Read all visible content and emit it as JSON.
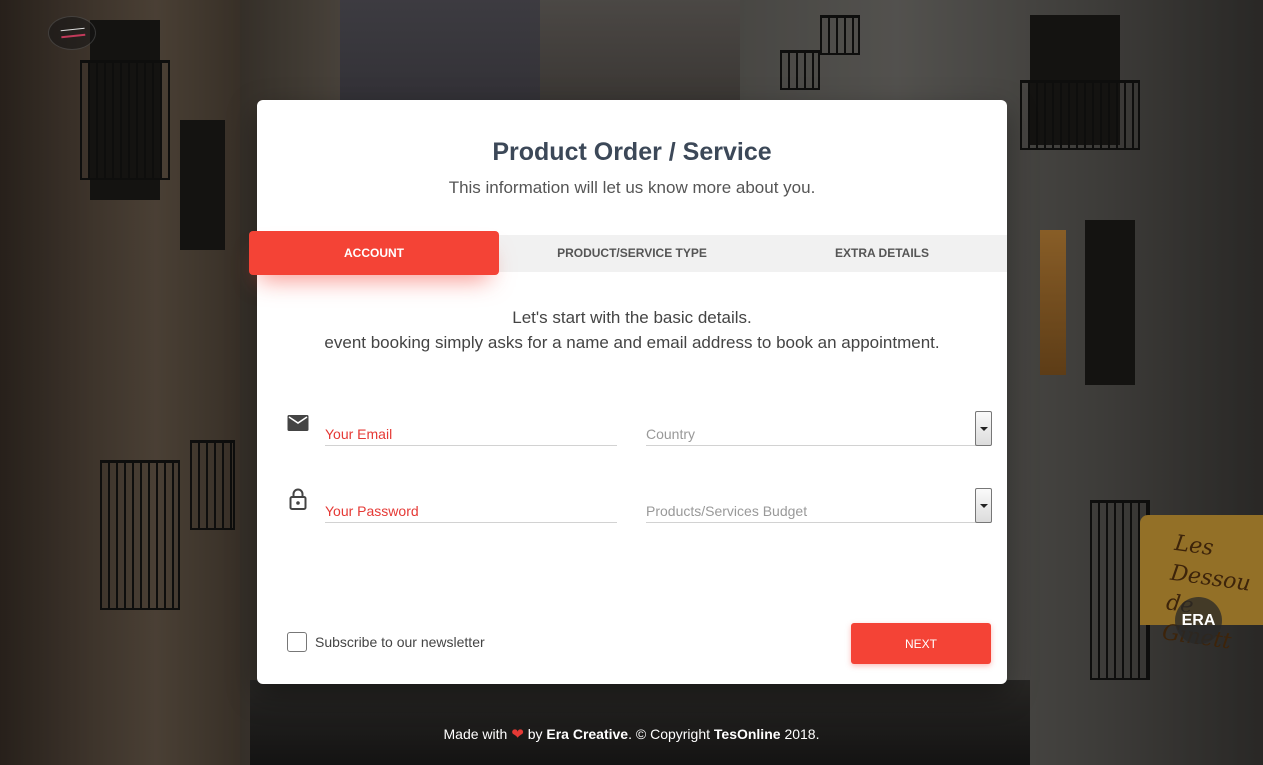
{
  "form": {
    "title": "Product Order / Service",
    "subtitle": "This information will let us know more about you.",
    "tabs": [
      {
        "label": "ACCOUNT",
        "active": true
      },
      {
        "label": "PRODUCT/SERVICE TYPE",
        "active": false
      },
      {
        "label": "EXTRA DETAILS",
        "active": false
      }
    ],
    "intro_line1": "Let's start with the basic details.",
    "intro_line2": "event booking simply asks for a name and email address to book an appointment.",
    "email_placeholder": "Your Email",
    "password_placeholder": "Your Password",
    "country_placeholder": "Country",
    "budget_placeholder": "Products/Services Budget",
    "newsletter_label": "Subscribe to our newsletter",
    "newsletter_checked": false,
    "next_label": "NEXT"
  },
  "footer": {
    "made_with": "Made with",
    "by": "by",
    "author": "Era Creative",
    "copyright": ". © Copyright",
    "company": "TesOnline",
    "year": "2018."
  },
  "badge": {
    "label": "ERA"
  },
  "icons": {
    "email": "envelope-icon",
    "password": "lock-icon",
    "heart": "heart-icon",
    "select": "chevron-down-icon"
  },
  "colors": {
    "accent": "#f44336",
    "title": "#3c4858",
    "placeholder_red": "#e53935"
  }
}
